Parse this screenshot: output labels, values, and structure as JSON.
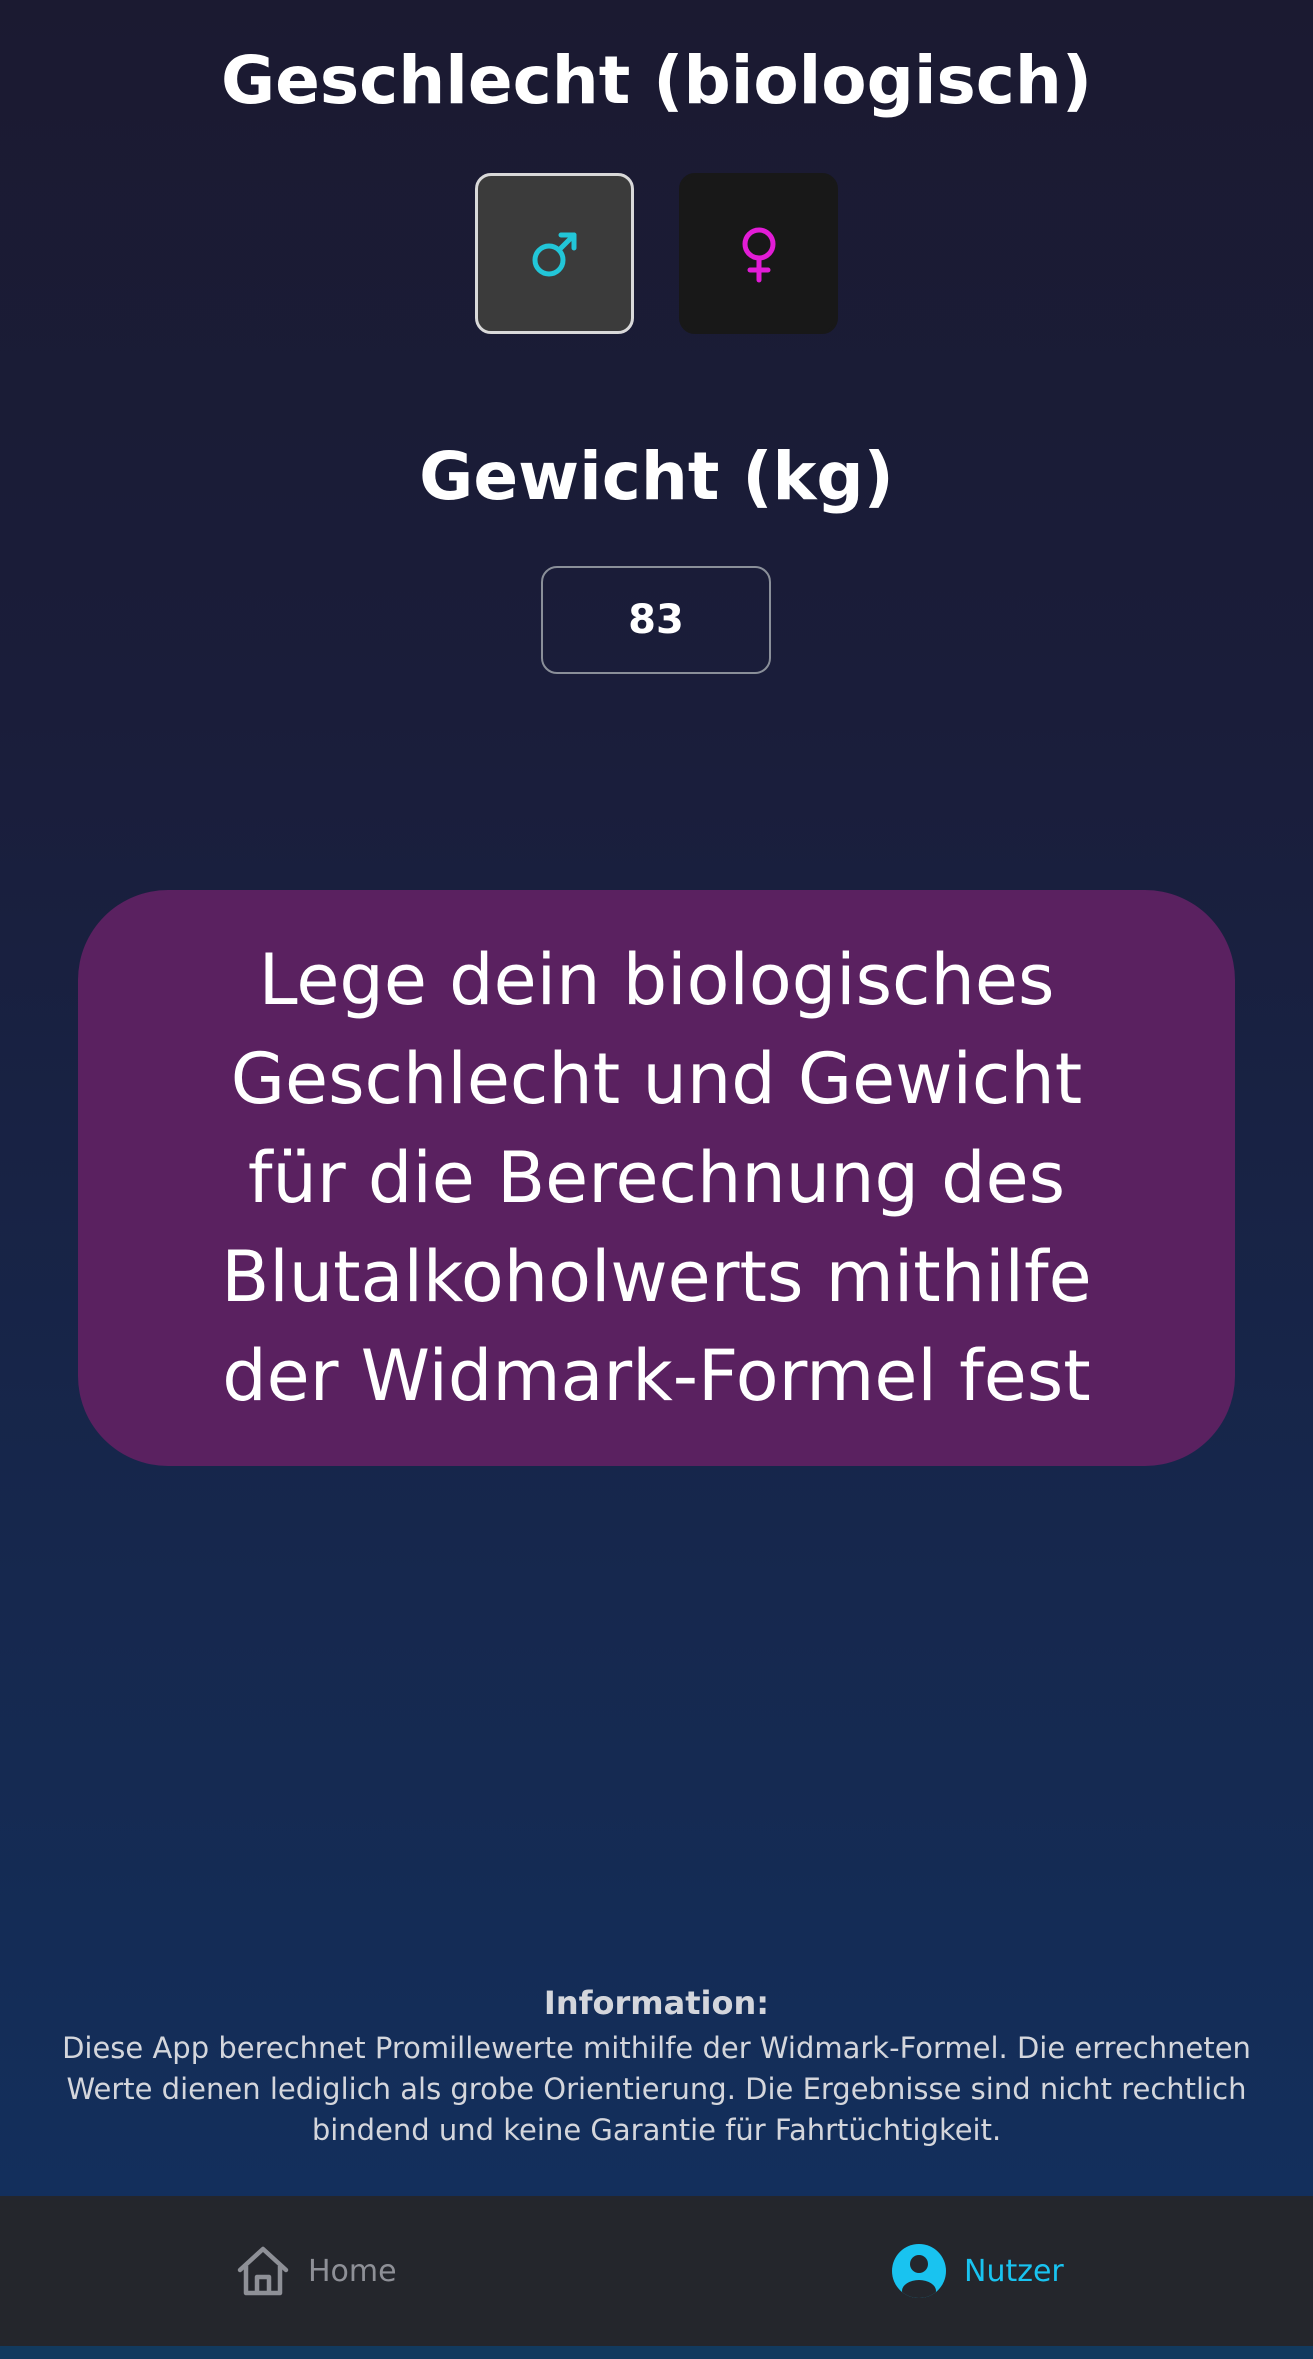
{
  "sex_section": {
    "title": "Geschlecht (biologisch)",
    "options": [
      {
        "icon": "male-icon",
        "selected": true,
        "color": "#22c6d8"
      },
      {
        "icon": "female-icon",
        "selected": false,
        "color": "#e21cd6"
      }
    ]
  },
  "weight_section": {
    "title": "Gewicht (kg)",
    "value": "83"
  },
  "info_bubble": {
    "text": "Lege dein biologisches\nGeschlecht und Gewicht\nfür die Berechnung des\nBlutalkoholwerts mithilfe\nder Widmark-Formel  fest",
    "background": "#5a2160"
  },
  "disclaimer": {
    "heading": "Information:",
    "body": "Diese App berechnet Promillewerte mithilfe der Widmark-Formel. Die errechneten Werte dienen lediglich als grobe Orientierung. Die Ergebnisse sind nicht rechtlich bindend und keine Garantie für Fahrtüchtigkeit."
  },
  "bottom_nav": {
    "items": [
      {
        "label": "Home",
        "icon": "home-icon",
        "active": false
      },
      {
        "label": "Nutzer",
        "icon": "user-icon",
        "active": true
      }
    ],
    "active_color": "#19c3f0"
  }
}
